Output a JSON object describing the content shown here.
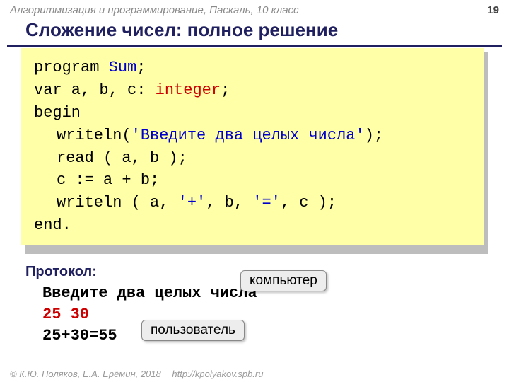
{
  "header": {
    "breadcrumb": "Алгоритмизация и программирование, Паскаль, 10 класс",
    "page": "19"
  },
  "title": "Сложение чисел: полное решение",
  "code": {
    "l1_a": "program ",
    "l1_b": "Sum",
    "l1_c": ";",
    "l2_a": "var a, b, c: ",
    "l2_b": "integer",
    "l2_c": ";",
    "l3": "begin",
    "l4_a": "writeln(",
    "l4_b": "'Введите два целых числа'",
    "l4_c": ");",
    "l5": "read ( a, b );",
    "l6": "c := a + b;",
    "l7_a": "writeln ( a, ",
    "l7_b": "'+'",
    "l7_c": ", b, ",
    "l7_d": "'='",
    "l7_e": ", c );",
    "l8": "end."
  },
  "protocol_label": "Протокол:",
  "protocol": {
    "line1": "Введите два целых числа",
    "line2": "25 30",
    "line3": "25+30=55"
  },
  "callout": {
    "computer": "компьютер",
    "user": "пользователь"
  },
  "footer": {
    "copy": "© К.Ю. Поляков, Е.А. Ерёмин, 2018",
    "url": "http://kpolyakov.spb.ru"
  }
}
